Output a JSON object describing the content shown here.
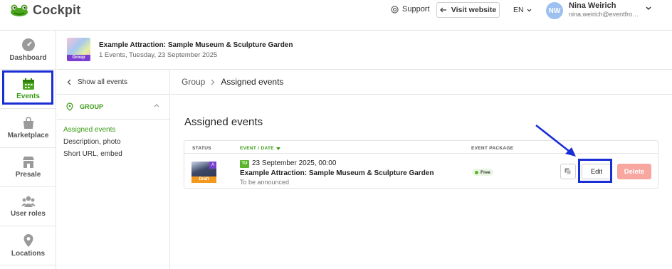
{
  "header": {
    "logo_text": "Cockpit",
    "support_label": "Support",
    "visit_website_label": "Visit website",
    "language": "EN",
    "user": {
      "initials": "NW",
      "name": "Nina Weirich",
      "email": "nina.weirich@eventfrog..."
    }
  },
  "sidebar": {
    "items": [
      {
        "label": "Dashboard",
        "icon": "dashboard-gauge-icon"
      },
      {
        "label": "Events",
        "icon": "calendar-icon",
        "active": true
      },
      {
        "label": "Marketplace",
        "icon": "shopping-bag-icon"
      },
      {
        "label": "Presale",
        "icon": "store-icon"
      },
      {
        "label": "User roles",
        "icon": "users-icon"
      },
      {
        "label": "Locations",
        "icon": "map-pin-icon"
      }
    ]
  },
  "attraction": {
    "thumb_tag": "Group",
    "title": "Example Attraction: Sample Museum & Sculpture Garden",
    "subtitle": "1 Events, Tuesday, 23 September 2025"
  },
  "subnav": {
    "back_label": "Show all events",
    "group_label": "GROUP",
    "links": [
      {
        "label": "Assigned events",
        "active": true
      },
      {
        "label": "Description, photo",
        "active": false
      },
      {
        "label": "Short URL, embed",
        "active": false
      }
    ]
  },
  "breadcrumb": {
    "parent": "Group",
    "current": "Assigned events"
  },
  "main": {
    "section_title": "Assigned events",
    "table": {
      "columns": {
        "status": "STATUS",
        "event_date": "EVENT / DATE",
        "package": "EVENT PACKAGE"
      },
      "rows": [
        {
          "thumb_tag": "Draft",
          "thumb_corner": "A",
          "day": "TU",
          "date": "23 September 2025, 00:00",
          "title": "Example Attraction: Sample Museum & Sculpture Garden",
          "location": "To be announced",
          "package": "Free",
          "edit_label": "Edit",
          "delete_label": "Delete"
        }
      ]
    }
  },
  "colors": {
    "brand_green": "#3a9a14",
    "highlight_blue": "#1a2ed6",
    "delete_red": "#f7a6a0",
    "draft_orange": "#f39a1e"
  }
}
